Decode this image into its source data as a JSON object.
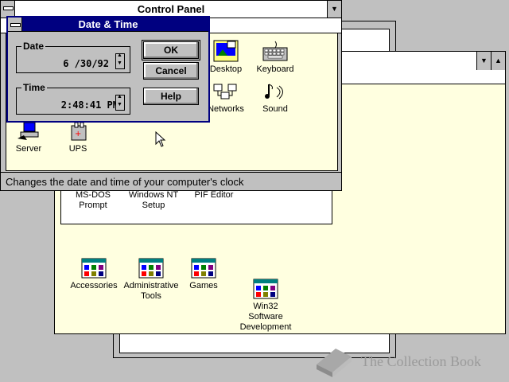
{
  "control_panel": {
    "title": "Control Panel",
    "status_text": "Changes the date and time of your computer's clock",
    "icons": [
      {
        "label": "Desktop",
        "icon": "desktop-icon"
      },
      {
        "label": "Keyboard",
        "icon": "keyboard-icon"
      },
      {
        "label": "Networks",
        "icon": "networks-icon"
      },
      {
        "label": "Sound",
        "icon": "sound-icon"
      },
      {
        "label": "Server",
        "icon": "server-icon"
      },
      {
        "label": "UPS",
        "icon": "ups-icon"
      }
    ]
  },
  "dialog": {
    "title": "Date & Time",
    "date_label": "Date",
    "date_value": "6 /30/92",
    "time_label": "Time",
    "time_value": "2:48:41 PM",
    "ok_label": "OK",
    "cancel_label": "Cancel",
    "help_label": "Help"
  },
  "program_group": {
    "items": [
      {
        "label_line1": "MS-DOS",
        "label_line2": "Prompt"
      },
      {
        "label_line1": "Windows NT",
        "label_line2": "Setup"
      },
      {
        "label_line1": "PIF Editor",
        "label_line2": ""
      }
    ]
  },
  "program_manager": {
    "groups": [
      {
        "label_line1": "Accessories",
        "label_line2": "",
        "label_line3": ""
      },
      {
        "label_line1": "Administrative",
        "label_line2": "Tools",
        "label_line3": ""
      },
      {
        "label_line1": "Games",
        "label_line2": "",
        "label_line3": ""
      },
      {
        "label_line1": "Win32",
        "label_line2": "Software",
        "label_line3": "Development"
      }
    ]
  },
  "watermark": {
    "text": "The Collection Book"
  }
}
